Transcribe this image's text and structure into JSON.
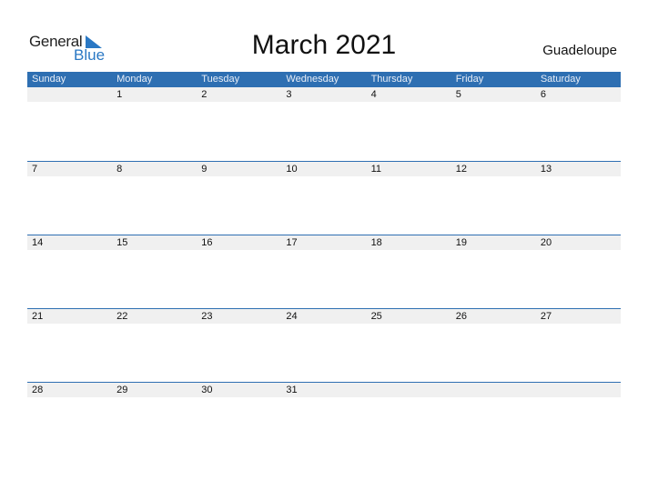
{
  "logo": {
    "line1": "General",
    "line2": "Blue"
  },
  "title": "March 2021",
  "region": "Guadeloupe",
  "colors": {
    "accent": "#2e6fb2",
    "strip": "#f0f0f0"
  },
  "weekdays": [
    "Sunday",
    "Monday",
    "Tuesday",
    "Wednesday",
    "Thursday",
    "Friday",
    "Saturday"
  ],
  "weeks": [
    [
      "",
      "1",
      "2",
      "3",
      "4",
      "5",
      "6"
    ],
    [
      "7",
      "8",
      "9",
      "10",
      "11",
      "12",
      "13"
    ],
    [
      "14",
      "15",
      "16",
      "17",
      "18",
      "19",
      "20"
    ],
    [
      "21",
      "22",
      "23",
      "24",
      "25",
      "26",
      "27"
    ],
    [
      "28",
      "29",
      "30",
      "31",
      "",
      "",
      ""
    ]
  ]
}
